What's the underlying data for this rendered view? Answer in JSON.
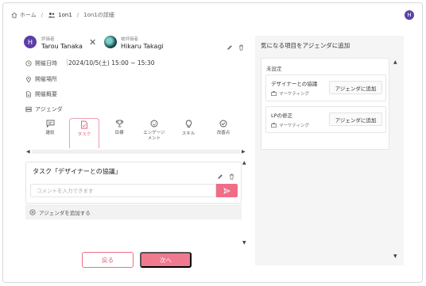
{
  "breadcrumb": {
    "home": "ホーム",
    "section": "1on1",
    "current": "1on1の詳細",
    "separator": "/"
  },
  "header": {
    "user_initial": "H"
  },
  "evaluator": {
    "role": "評価者",
    "name": "Tarou Tanaka",
    "initial": "H"
  },
  "evaluatee": {
    "role": "被評価者",
    "name": "Hikaru Takagi"
  },
  "info": {
    "datetime_label": "開催日時",
    "datetime_value": "2024/10/5(土) 15:00 ~ 15:30",
    "place_label": "開催場所",
    "summary_label": "開催概要",
    "agenda_label": "アジェンダ"
  },
  "tabs": [
    {
      "label": "雑談",
      "icon": "chat-icon"
    },
    {
      "label": "タスク",
      "icon": "document-icon",
      "active": true
    },
    {
      "label": "目標",
      "icon": "trophy-icon"
    },
    {
      "label": "エンゲージ\nメント",
      "icon": "smile-icon"
    },
    {
      "label": "スキル",
      "icon": "lightbulb-icon"
    },
    {
      "label": "改善点",
      "icon": "check-circle-icon"
    }
  ],
  "agenda_item": {
    "title": "タスク「デザイナーとの協議」",
    "comment_placeholder": "コメントを入力できます"
  },
  "add_agenda_label": "アジェンダを追加する",
  "buttons": {
    "back": "戻る",
    "next": "次へ"
  },
  "right_panel": {
    "title": "気になる項目をアジェンダに追加",
    "section": "未設定",
    "topics": [
      {
        "title": "デザイナーとの協議",
        "tag": "マーケティング",
        "button": "アジェンダに追加"
      },
      {
        "title": "LPの修正",
        "tag": "マーケティング",
        "button": "アジェンダに追加"
      }
    ]
  },
  "colors": {
    "accent": "#ef6e86",
    "avatar": "#5b3fa8"
  }
}
